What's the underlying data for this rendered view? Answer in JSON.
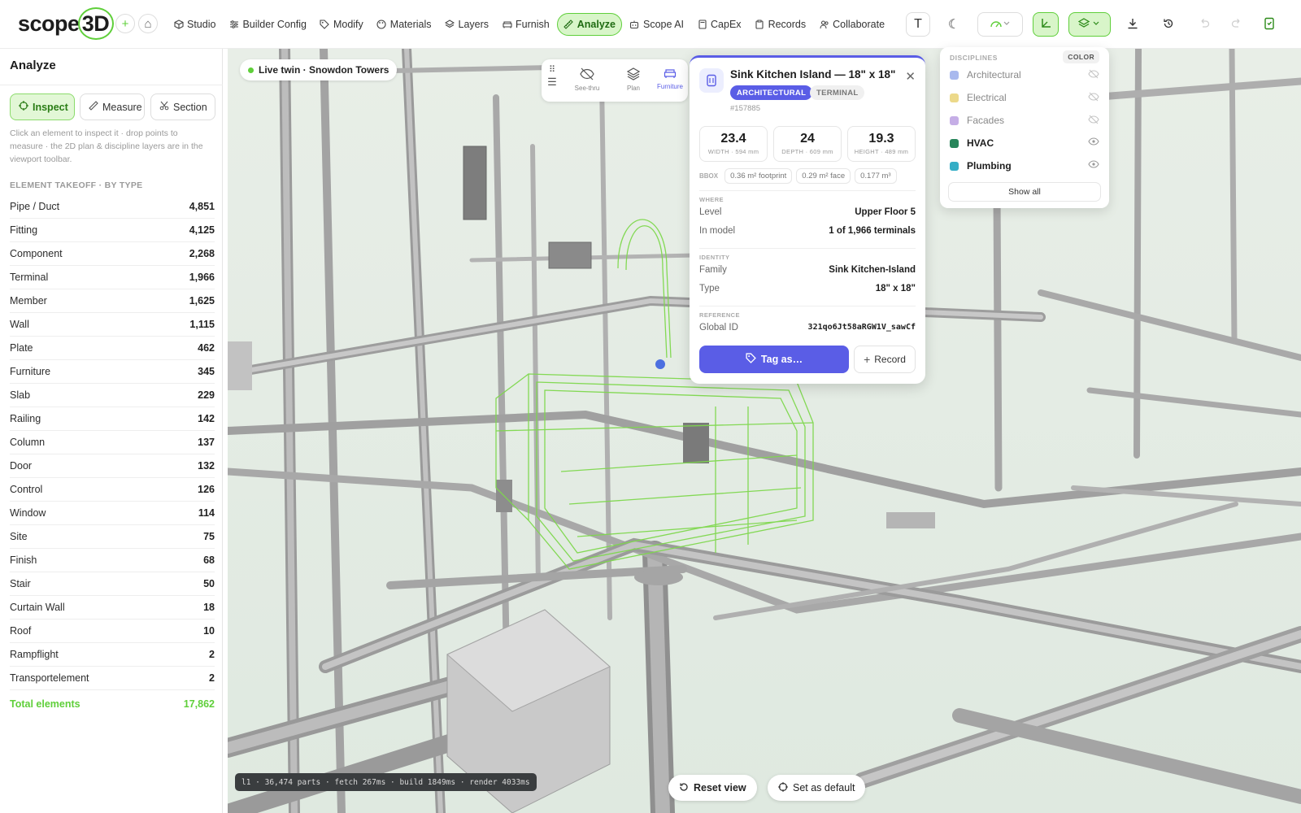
{
  "app": {
    "logo_text": "scope",
    "logo_ring_text": "3D"
  },
  "nav": {
    "items": [
      {
        "label": "Studio",
        "icon": "cube-icon"
      },
      {
        "label": "Builder Config",
        "icon": "sliders-icon"
      },
      {
        "label": "Modify",
        "icon": "tag-icon"
      },
      {
        "label": "Materials",
        "icon": "palette-icon"
      },
      {
        "label": "Layers",
        "icon": "layers-icon"
      },
      {
        "label": "Furnish",
        "icon": "sofa-icon"
      },
      {
        "label": "Analyze",
        "icon": "ruler-icon"
      },
      {
        "label": "Scope AI",
        "icon": "robot-icon"
      },
      {
        "label": "CapEx",
        "icon": "calculator-icon"
      },
      {
        "label": "Records",
        "icon": "clipboard-icon"
      },
      {
        "label": "Collaborate",
        "icon": "users-icon"
      }
    ],
    "active": "Analyze"
  },
  "toolbar": {
    "text_glyph": "T",
    "moon_glyph": "☾",
    "plus_glyph": "+",
    "home_glyph": "⌂"
  },
  "panel": {
    "title": "Analyze",
    "modes": [
      "Inspect",
      "Measure",
      "Section"
    ],
    "hint": "Click an element to inspect it · drop points to measure · the 2D plan & discipline layers are in the viewport toolbar.",
    "takeoff_heading": "ELEMENT TAKEOFF · BY TYPE",
    "takeoff": [
      {
        "type": "Pipe / Duct",
        "count": "4,851"
      },
      {
        "type": "Fitting",
        "count": "4,125"
      },
      {
        "type": "Component",
        "count": "2,268"
      },
      {
        "type": "Terminal",
        "count": "1,966"
      },
      {
        "type": "Member",
        "count": "1,625"
      },
      {
        "type": "Wall",
        "count": "1,115"
      },
      {
        "type": "Plate",
        "count": "462"
      },
      {
        "type": "Furniture",
        "count": "345"
      },
      {
        "type": "Slab",
        "count": "229"
      },
      {
        "type": "Railing",
        "count": "142"
      },
      {
        "type": "Column",
        "count": "137"
      },
      {
        "type": "Door",
        "count": "132"
      },
      {
        "type": "Control",
        "count": "126"
      },
      {
        "type": "Window",
        "count": "114"
      },
      {
        "type": "Site",
        "count": "75"
      },
      {
        "type": "Finish",
        "count": "68"
      },
      {
        "type": "Stair",
        "count": "50"
      },
      {
        "type": "Curtain Wall",
        "count": "18"
      },
      {
        "type": "Roof",
        "count": "10"
      },
      {
        "type": "Rampflight",
        "count": "2"
      },
      {
        "type": "Transportelement",
        "count": "2"
      }
    ],
    "total_label": "Total elements",
    "total_value": "17,862"
  },
  "viewport": {
    "live_label": "Live twin · Snowdon Towers",
    "tools": [
      {
        "label": "See-thru",
        "icon": "eye-off-icon"
      },
      {
        "label": "Plan",
        "icon": "layers-icon"
      },
      {
        "label": "Furniture",
        "icon": "sofa-icon"
      }
    ],
    "status": "l1 · 36,474 parts · fetch 267ms · build 1849ms · render 4033ms",
    "reset_label": "Reset view",
    "default_label": "Set as default"
  },
  "inspect": {
    "title": "Sink Kitchen Island — 18\" x 18\"",
    "tags": [
      "ARCHITECTURAL",
      "TERMINAL"
    ],
    "id": "#157885",
    "dims": [
      {
        "value": "23.4",
        "label": "WIDTH · 594 mm"
      },
      {
        "value": "24",
        "label": "DEPTH · 609 mm"
      },
      {
        "value": "19.3",
        "label": "HEIGHT · 489 mm"
      }
    ],
    "bbox_label": "BBOX",
    "bbox": [
      "0.36 m² footprint",
      "0.29 m² face",
      "0.177 m³"
    ],
    "where_heading": "WHERE",
    "level_label": "Level",
    "level_value": "Upper Floor 5",
    "inmodel_label": "In model",
    "inmodel_value": "1 of 1,966 terminals",
    "identity_heading": "IDENTITY",
    "family_label": "Family",
    "family_value": "Sink Kitchen-Island",
    "type_label": "Type",
    "type_value": "18\" x 18\"",
    "reference_heading": "REFERENCE",
    "gid_label": "Global ID",
    "gid_value": "321qo6Jt58aRGW1V_sawCf",
    "tag_button": "Tag as…",
    "record_button": "Record"
  },
  "disciplines": {
    "heading": "DISCIPLINES",
    "color_button": "COLOR",
    "items": [
      {
        "label": "Architectural",
        "color": "#a9b9ee",
        "visible": false
      },
      {
        "label": "Electrical",
        "color": "#ecd98a",
        "visible": false
      },
      {
        "label": "Facades",
        "color": "#c5aee6",
        "visible": false
      },
      {
        "label": "HVAC",
        "color": "#27855a",
        "visible": true
      },
      {
        "label": "Plumbing",
        "color": "#35aec6",
        "visible": true
      }
    ],
    "show_all": "Show all"
  },
  "colors": {
    "accent_green": "#5fcf3a",
    "accent_indigo": "#5a5de6"
  }
}
